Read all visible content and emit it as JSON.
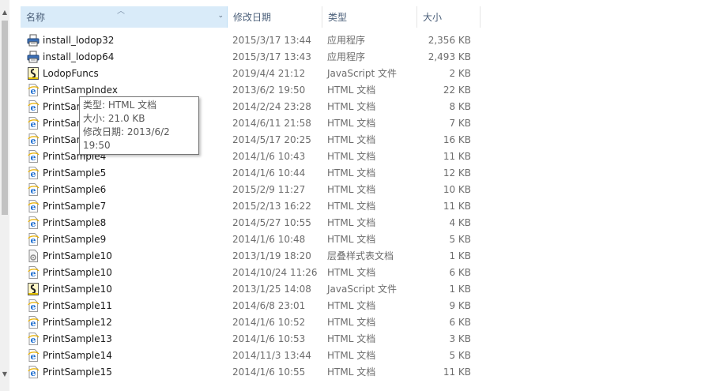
{
  "columns": {
    "name": "名称",
    "date": "修改日期",
    "type": "类型",
    "size": "大小"
  },
  "files": [
    {
      "name": "install_lodop32",
      "date": "2015/3/17 13:44",
      "type": "应用程序",
      "size": "2,356 KB",
      "icon": "printer-app-icon"
    },
    {
      "name": "install_lodop64",
      "date": "2015/3/17 13:43",
      "type": "应用程序",
      "size": "2,493 KB",
      "icon": "printer-app-icon"
    },
    {
      "name": "LodopFuncs",
      "date": "2019/4/4 21:12",
      "type": "JavaScript 文件",
      "size": "2 KB",
      "icon": "javascript-file-icon"
    },
    {
      "name": "PrintSampIndex",
      "date": "2013/6/2 19:50",
      "type": "HTML 文档",
      "size": "22 KB",
      "icon": "html-file-icon"
    },
    {
      "name": "PrintSample1",
      "date": "2014/2/24 23:28",
      "type": "HTML 文档",
      "size": "8 KB",
      "icon": "html-file-icon"
    },
    {
      "name": "PrintSample2",
      "date": "2014/6/11 21:58",
      "type": "HTML 文档",
      "size": "7 KB",
      "icon": "html-file-icon"
    },
    {
      "name": "PrintSample3",
      "date": "2014/5/17 20:25",
      "type": "HTML 文档",
      "size": "16 KB",
      "icon": "html-file-icon"
    },
    {
      "name": "PrintSample4",
      "date": "2014/1/6 10:43",
      "type": "HTML 文档",
      "size": "11 KB",
      "icon": "html-file-icon"
    },
    {
      "name": "PrintSample5",
      "date": "2014/1/6 10:44",
      "type": "HTML 文档",
      "size": "12 KB",
      "icon": "html-file-icon"
    },
    {
      "name": "PrintSample6",
      "date": "2015/2/9 11:27",
      "type": "HTML 文档",
      "size": "10 KB",
      "icon": "html-file-icon"
    },
    {
      "name": "PrintSample7",
      "date": "2015/2/13 16:22",
      "type": "HTML 文档",
      "size": "11 KB",
      "icon": "html-file-icon"
    },
    {
      "name": "PrintSample8",
      "date": "2014/5/27 10:55",
      "type": "HTML 文档",
      "size": "4 KB",
      "icon": "html-file-icon"
    },
    {
      "name": "PrintSample9",
      "date": "2014/1/6 10:48",
      "type": "HTML 文档",
      "size": "5 KB",
      "icon": "html-file-icon"
    },
    {
      "name": "PrintSample10",
      "date": "2013/1/19 18:20",
      "type": "层叠样式表文档",
      "size": "1 KB",
      "icon": "css-file-icon"
    },
    {
      "name": "PrintSample10",
      "date": "2014/10/24 11:26",
      "type": "HTML 文档",
      "size": "6 KB",
      "icon": "html-file-icon"
    },
    {
      "name": "PrintSample10",
      "date": "2013/1/25 14:08",
      "type": "JavaScript 文件",
      "size": "1 KB",
      "icon": "javascript-file-icon"
    },
    {
      "name": "PrintSample11",
      "date": "2014/6/8 23:01",
      "type": "HTML 文档",
      "size": "9 KB",
      "icon": "html-file-icon"
    },
    {
      "name": "PrintSample12",
      "date": "2014/1/6 10:52",
      "type": "HTML 文档",
      "size": "6 KB",
      "icon": "html-file-icon"
    },
    {
      "name": "PrintSample13",
      "date": "2014/1/6 10:53",
      "type": "HTML 文档",
      "size": "3 KB",
      "icon": "html-file-icon"
    },
    {
      "name": "PrintSample14",
      "date": "2014/11/3 13:44",
      "type": "HTML 文档",
      "size": "5 KB",
      "icon": "html-file-icon"
    },
    {
      "name": "PrintSample15",
      "date": "2014/1/6 10:55",
      "type": "HTML 文档",
      "size": "11 KB",
      "icon": "html-file-icon"
    }
  ],
  "tooltip": {
    "type_line": "类型: HTML 文档",
    "size_line": "大小: 21.0 KB",
    "date_line": "修改日期: 2013/6/2 19:50"
  },
  "colors": {
    "header_selected": "#d9ebf9",
    "header_text": "#4c607a",
    "ie_blue": "#1f6fd1"
  }
}
